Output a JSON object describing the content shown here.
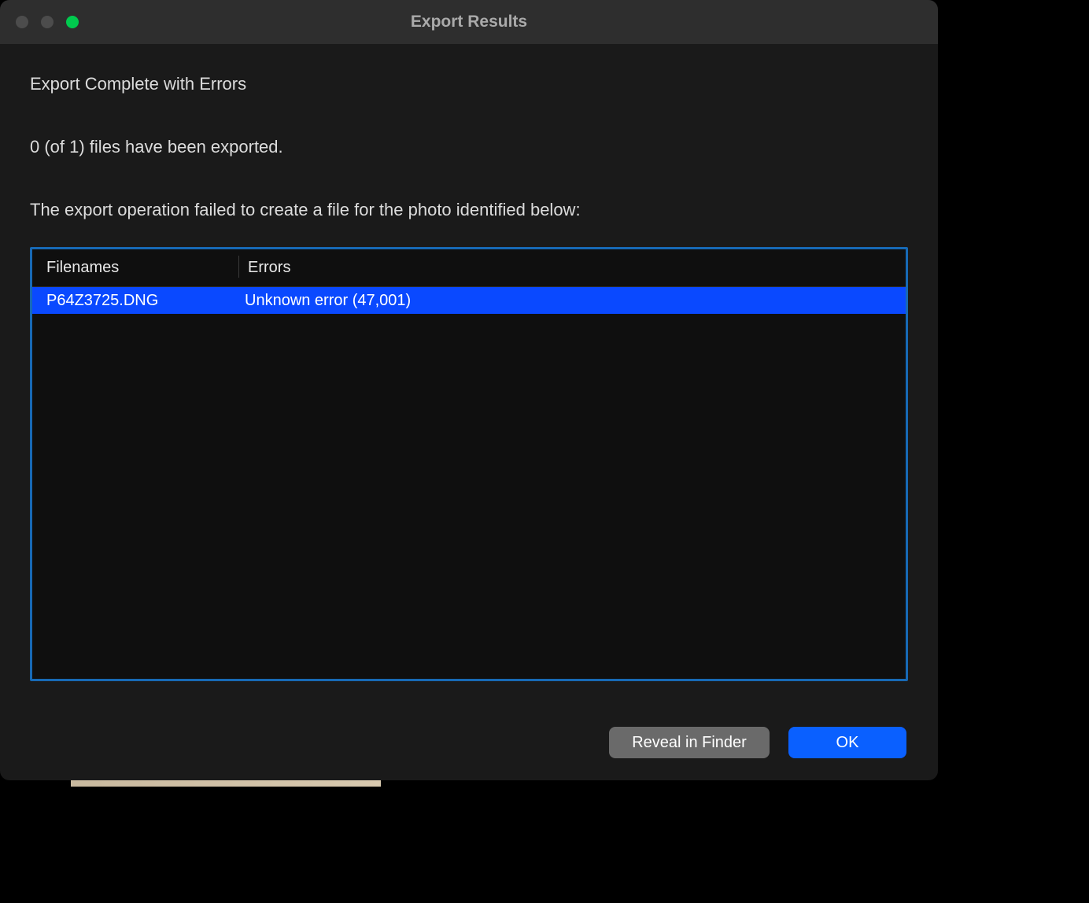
{
  "window": {
    "title": "Export Results"
  },
  "content": {
    "heading": "Export Complete with Errors",
    "status_line": "0 (of 1) files have been exported.",
    "description": "The export operation failed to create a file for the photo identified below:"
  },
  "table": {
    "columns": {
      "filenames": "Filenames",
      "errors": "Errors"
    },
    "rows": [
      {
        "filename": "P64Z3725.DNG",
        "error": "Unknown error (47,001)",
        "selected": true
      }
    ]
  },
  "buttons": {
    "reveal": "Reveal in Finder",
    "ok": "OK"
  }
}
